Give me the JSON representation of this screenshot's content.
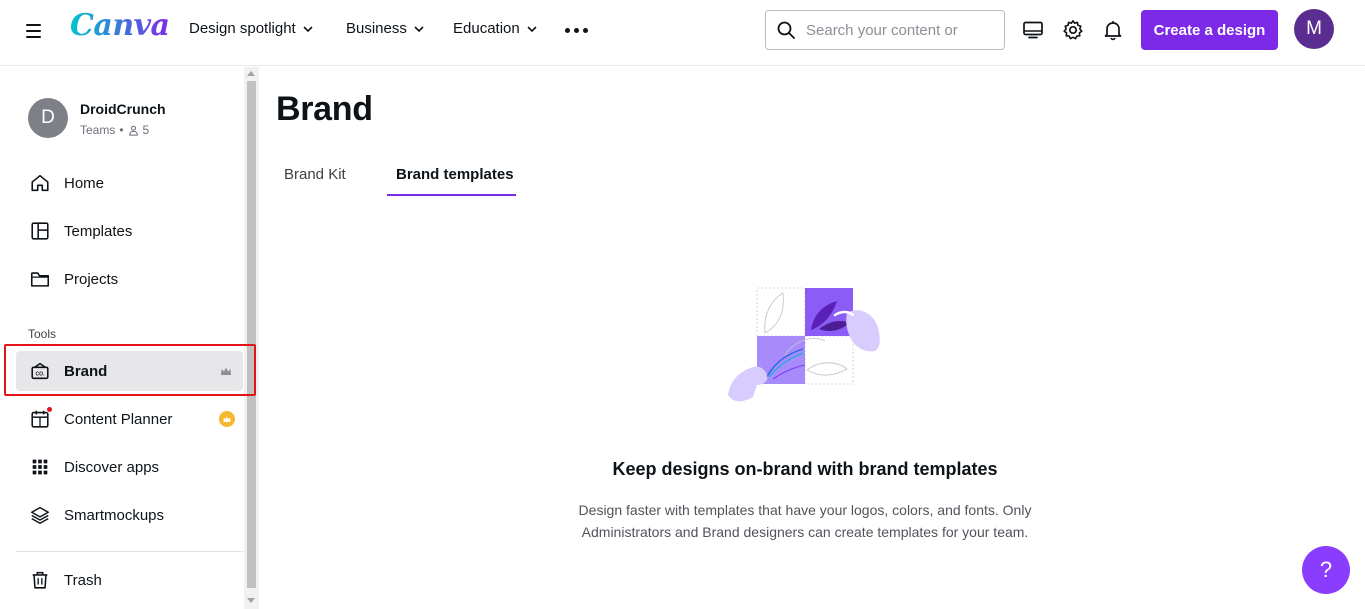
{
  "app": {
    "logo_text": "Canva",
    "brand_colors": {
      "accent": "#7d2ae8",
      "help": "#8b3dff",
      "highlight": "#e5141c"
    }
  },
  "topnav": {
    "items": [
      {
        "label": "Design spotlight",
        "icon": "chevron-down-icon"
      },
      {
        "label": "Business",
        "icon": "chevron-down-icon"
      },
      {
        "label": "Education",
        "icon": "chevron-down-icon"
      }
    ],
    "more_icon": "more-dots-icon"
  },
  "search": {
    "placeholder": "Search your content or",
    "value": ""
  },
  "header_icons": [
    "desktop-icon",
    "gear-icon",
    "bell-icon"
  ],
  "create_button_label": "Create a design",
  "user_avatar_initial": "M",
  "team": {
    "initial": "D",
    "name": "DroidCrunch",
    "type": "Teams",
    "separator": "•",
    "member_count": "5"
  },
  "sidebar": {
    "items": [
      {
        "label": "Home",
        "icon": "home-icon"
      },
      {
        "label": "Templates",
        "icon": "templates-icon"
      },
      {
        "label": "Projects",
        "icon": "folder-icon"
      }
    ],
    "tools_label": "Tools",
    "tools": [
      {
        "label": "Brand",
        "icon": "brand-icon",
        "badge": "crown-icon",
        "active": true
      },
      {
        "label": "Content Planner",
        "icon": "calendar-icon",
        "badge": "crown-badge-icon"
      },
      {
        "label": "Discover apps",
        "icon": "apps-grid-icon"
      },
      {
        "label": "Smartmockups",
        "icon": "layers-icon"
      }
    ],
    "trash": {
      "label": "Trash",
      "icon": "trash-icon"
    }
  },
  "main": {
    "title": "Brand",
    "tabs": [
      {
        "label": "Brand Kit",
        "active": false
      },
      {
        "label": "Brand templates",
        "active": true
      }
    ],
    "empty_state": {
      "illustration": "brand-templates-illustration",
      "title": "Keep designs on-brand with brand templates",
      "description_line1": "Design faster with templates that have your logos, colors, and fonts. Only",
      "description_line2": "Administrators and Brand designers can create templates for your team."
    }
  },
  "help_button_label": "?"
}
